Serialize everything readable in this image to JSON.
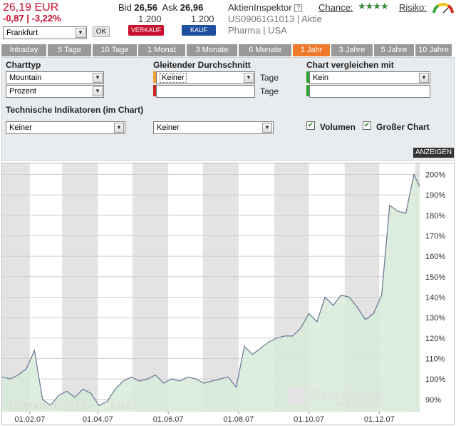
{
  "quote": {
    "price": "26,19 EUR",
    "change": "-0,87 | -3,22%",
    "bid_label": "Bid",
    "bid": "26,56",
    "ask_label": "Ask",
    "ask": "26,96",
    "bid_qty": "1.200",
    "ask_qty": "1.200",
    "inspector": "AktienInspektor",
    "help": "?",
    "isin_line": "US09061G1013 | Aktie",
    "branche_line": "Pharma | USA",
    "chance_label": "Chance:",
    "stars": "★★★★",
    "risk_label": "Risiko:",
    "exchange": "Frankfurt",
    "ok": "OK",
    "sell": "VERKAUF",
    "buy": "KAUF"
  },
  "tabs": [
    {
      "label": "Intraday"
    },
    {
      "label": "5 Tage"
    },
    {
      "label": "10 Tage"
    },
    {
      "label": "1 Monat"
    },
    {
      "label": "3 Monate"
    },
    {
      "label": "6 Monate"
    },
    {
      "label": "1 Jahr"
    },
    {
      "label": "3 Jahre"
    },
    {
      "label": "5 Jahre"
    },
    {
      "label": "10 Jahre"
    }
  ],
  "active_tab": "1 Jahr",
  "settings": {
    "charttyp_label": "Charttyp",
    "charttyp": "Mountain",
    "scale": "Prozent",
    "gd_label": "Gleitender Durchschnitt",
    "gd1": "Keiner",
    "gd2": "",
    "tage": "Tage",
    "compare_label": "Chart vergleichen mit",
    "compare": "Kein",
    "compare_input": "",
    "ti_label": "Technische Indikatoren (im Chart)",
    "ti1": "Keiner",
    "ti2": "Keiner",
    "volumen": "Volumen",
    "gross": "Großer Chart",
    "show": "ANZEIGEN"
  },
  "chart_data": {
    "type": "area",
    "title": "",
    "xlabel": "",
    "ylabel": "",
    "x_ticks": [
      "01.02.07",
      "01.04.07",
      "01.06.07",
      "01.08.07",
      "01.10.07",
      "01.12.07"
    ],
    "y_ticks": [
      "90%",
      "100%",
      "110%",
      "120%",
      "130%",
      "140%",
      "150%",
      "160%",
      "170%",
      "180%",
      "190%",
      "200%"
    ],
    "ylim": [
      84,
      204
    ],
    "xlim": [
      "2007-01-08",
      "2008-01-05"
    ],
    "grid": "vertical bands + horizontal lines",
    "watermark_isin": "US09061G1013",
    "watermark_exchange": "FRA",
    "watermark_brand": "Cortal Consors",
    "watermark_brand_sub": "BNP PARIBAS",
    "series": [
      {
        "x": [
          "2007-01-08",
          "2007-01-15",
          "2007-01-22",
          "2007-01-29",
          "2007-02-05",
          "2007-02-12",
          "2007-02-19",
          "2007-02-26",
          "2007-03-05",
          "2007-03-12",
          "2007-03-19",
          "2007-03-26",
          "2007-04-02",
          "2007-04-09",
          "2007-04-16",
          "2007-04-23",
          "2007-04-30",
          "2007-05-07",
          "2007-05-14",
          "2007-05-21",
          "2007-05-28",
          "2007-06-04",
          "2007-06-11",
          "2007-06-18",
          "2007-06-25",
          "2007-07-02",
          "2007-07-09",
          "2007-07-16",
          "2007-07-23",
          "2007-07-30",
          "2007-08-06",
          "2007-08-13",
          "2007-08-20",
          "2007-08-27",
          "2007-09-03",
          "2007-09-10",
          "2007-09-17",
          "2007-09-24",
          "2007-10-01",
          "2007-10-08",
          "2007-10-15",
          "2007-10-22",
          "2007-10-29",
          "2007-11-05",
          "2007-11-12",
          "2007-11-19",
          "2007-11-26",
          "2007-12-03",
          "2007-12-10",
          "2007-12-17",
          "2007-12-24",
          "2007-12-31",
          "2008-01-05"
        ],
        "values": [
          101,
          100,
          102,
          105,
          114,
          90,
          87,
          92,
          94,
          91,
          95,
          93,
          87,
          89,
          95,
          99,
          101,
          99,
          100,
          102,
          98,
          100,
          99,
          101,
          100,
          98,
          99,
          100,
          101,
          96,
          116,
          112,
          115,
          118,
          120,
          121,
          121,
          125,
          132,
          128,
          140,
          136,
          141,
          140,
          135,
          129,
          132,
          141,
          185,
          182,
          181,
          200,
          194
        ]
      }
    ]
  }
}
